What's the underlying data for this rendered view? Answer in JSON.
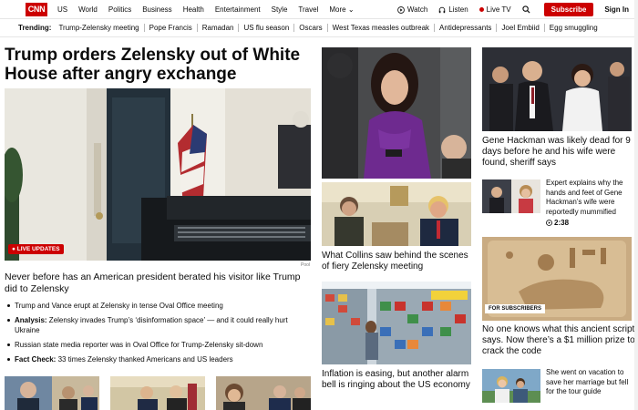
{
  "nav": {
    "logo": "CNN",
    "links": [
      "US",
      "World",
      "Politics",
      "Business",
      "Health",
      "Entertainment",
      "Style",
      "Travel",
      "More"
    ],
    "watch": "Watch",
    "listen": "Listen",
    "live_tv": "Live TV",
    "subscribe": "Subscribe",
    "sign_in": "Sign In"
  },
  "trending": {
    "label": "Trending:",
    "items": [
      "Trump-Zelensky meeting",
      "Pope Francis",
      "Ramadan",
      "US flu season",
      "Oscars",
      "West Texas measles outbreak",
      "Antidepressants",
      "Joel Embiid",
      "Egg smuggling"
    ]
  },
  "lead": {
    "headline": "Trump orders Zelensky out of White House after angry exchange",
    "live_badge": "LIVE UPDATES",
    "photo_credit": "Pool",
    "subheadline": "Never before has an American president berated his visitor like Trump did to Zelensky",
    "bullets": [
      {
        "prefix": "",
        "text": "Trump and Vance erupt at Zelensky in tense Oval Office meeting"
      },
      {
        "prefix": "Analysis:",
        "text": " Zelensky invades Trump’s ‘disinformation space’ — and it could really hurt Ukraine"
      },
      {
        "prefix": "",
        "text": "Russian state media reporter was in Oval Office for Trump-Zelensky sit-down"
      },
      {
        "prefix": "Fact Check:",
        "text": " 33 times Zelensky thanked Americans and US leaders"
      }
    ]
  },
  "middle": {
    "caption1": "What Collins saw behind the scenes of fiery Zelensky meeting",
    "caption2": "Inflation is easing, but another alarm bell is ringing about the US economy"
  },
  "right": {
    "caption1": "Gene Hackman was likely dead for 9 days before he and his wife were found, sheriff says",
    "caption2": "Expert explains why the hands and feet of Gene Hackman’s wife were reportedly mummified",
    "duration": "2:38",
    "subscribers_badge": "FOR SUBSCRIBERS",
    "caption3": "No one knows what this ancient script says. Now there’s a $1 million prize to crack the code",
    "caption4": "She went on vacation to save her marriage but fell for the tour guide"
  },
  "colors": {
    "brand_red": "#cc0000",
    "text": "#0c0c0c"
  }
}
